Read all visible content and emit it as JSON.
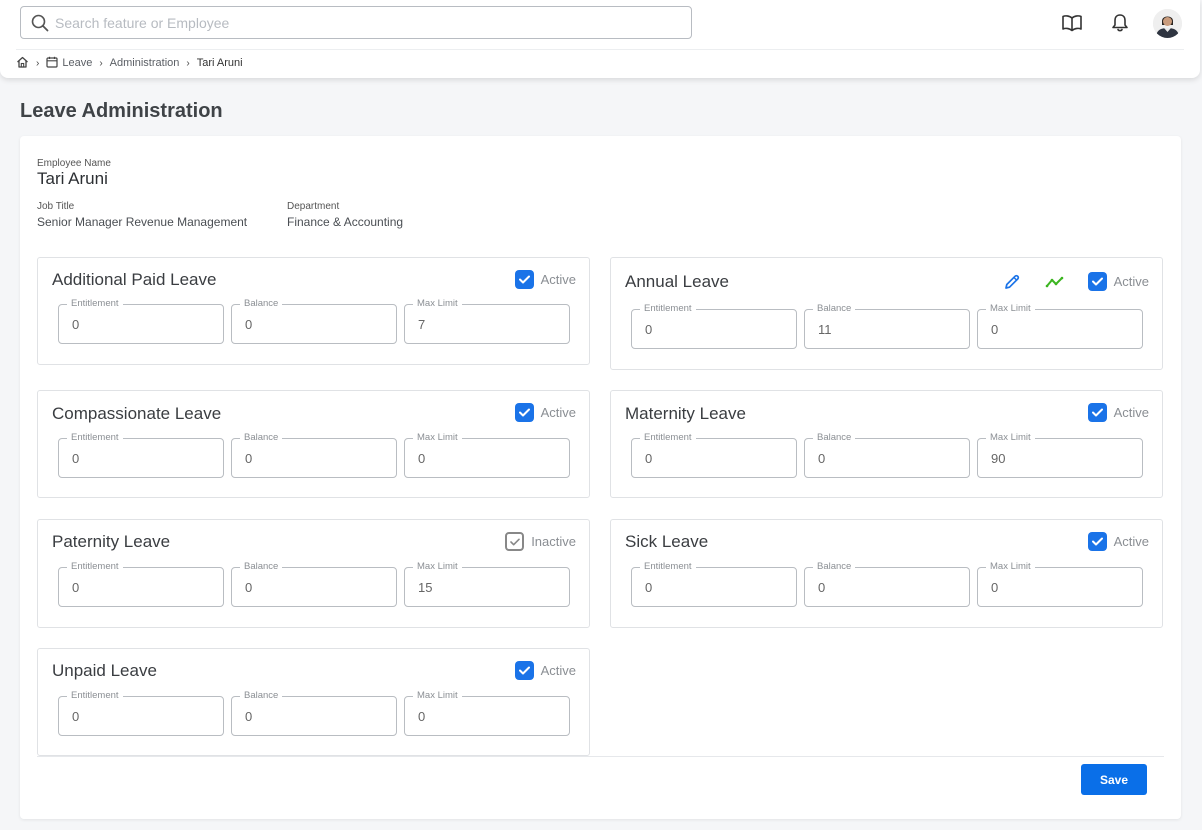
{
  "search": {
    "placeholder": "Search feature or Employee"
  },
  "breadcrumb": {
    "items": [
      "Leave",
      "Administration",
      "Tari Aruni"
    ]
  },
  "page_title": "Leave Administration",
  "employee": {
    "name_label": "Employee Name",
    "name": "Tari Aruni",
    "job_title_label": "Job Title",
    "job_title": "Senior Manager Revenue Management",
    "department_label": "Department",
    "department": "Finance & Accounting"
  },
  "field_labels": {
    "entitlement": "Entitlement",
    "balance": "Balance",
    "max_limit": "Max Limit"
  },
  "leaves": [
    {
      "title": "Additional Paid Leave",
      "status": "Active",
      "checked": true,
      "entitlement": "0",
      "balance": "0",
      "max_limit": "7"
    },
    {
      "title": "Annual Leave",
      "status": "Active",
      "checked": true,
      "entitlement": "0",
      "balance": "11",
      "max_limit": "0"
    },
    {
      "title": "Compassionate Leave",
      "status": "Active",
      "checked": true,
      "entitlement": "0",
      "balance": "0",
      "max_limit": "0"
    },
    {
      "title": "Maternity Leave",
      "status": "Active",
      "checked": true,
      "entitlement": "0",
      "balance": "0",
      "max_limit": "90"
    },
    {
      "title": "Paternity Leave",
      "status": "Inactive",
      "checked": false,
      "entitlement": "0",
      "balance": "0",
      "max_limit": "15"
    },
    {
      "title": "Sick Leave",
      "status": "Active",
      "checked": true,
      "entitlement": "0",
      "balance": "0",
      "max_limit": "0"
    },
    {
      "title": "Unpaid Leave",
      "status": "Active",
      "checked": true,
      "entitlement": "0",
      "balance": "0",
      "max_limit": "0"
    }
  ],
  "save_label": "Save",
  "colors": {
    "accent": "#1a73e8",
    "edit_icon": "#1a73e8",
    "trend_icon": "#3cb521"
  }
}
